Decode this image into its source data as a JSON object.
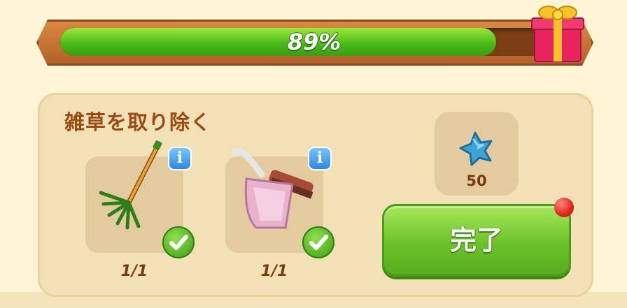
{
  "progress": {
    "percent_text": "89%",
    "fill_fraction": 0.89
  },
  "task": {
    "title": "雑草を取り除く",
    "items": [
      {
        "name": "rake",
        "count": "1/1",
        "completed": true
      },
      {
        "name": "dustpan-and-brush",
        "count": "1/1",
        "completed": true
      }
    ]
  },
  "reward": {
    "icon": "blue-star-icon",
    "value": "50"
  },
  "complete_button": {
    "label": "完了"
  },
  "icons": {
    "info": "i",
    "gift": "gift-icon"
  },
  "colors": {
    "progress_fill": "#45b817",
    "button_green": "#6cc22b",
    "title_brown": "#9a4a14",
    "info_blue": "#2e86e0",
    "notification_red": "#e0221b"
  }
}
